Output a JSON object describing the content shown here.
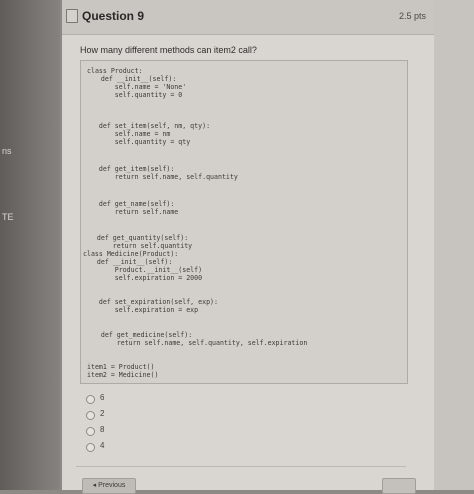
{
  "sidebar": {
    "fragment_1": "ns",
    "fragment_2": "TE"
  },
  "question": {
    "title": "Question 9",
    "points": "2.5 pts",
    "prompt": "How many different methods can item2 call?"
  },
  "code": [
    "class Product:",
    "    def __init__(self):",
    "        self.name = 'None'",
    "        self.quantity = 0",
    "",
    "    def set_item(self, nm, qty):",
    "        self.name = nm",
    "        self.quantity = qty",
    "",
    "    def get_item(self):",
    "        return self.name, self.quantity",
    "",
    "    def get_name(self):",
    "        return self.name",
    "",
    "    def get_quantity(self):",
    "        return self.quantity",
    "class Medicine(Product):",
    "    def __init__(self):",
    "        Product.__init__(self)",
    "        self.expiration = 2000",
    "",
    "    def set_expiration(self, exp):",
    "        self.expiration = exp",
    "",
    "    def get_medicine(self):",
    "        return self.name, self.quantity, self.expiration",
    "",
    "item1 = Product()",
    "item2 = Medicine()"
  ],
  "answers": [
    "6",
    "2",
    "8",
    "4"
  ],
  "navigation": {
    "previous_label": "◂ Previous"
  }
}
